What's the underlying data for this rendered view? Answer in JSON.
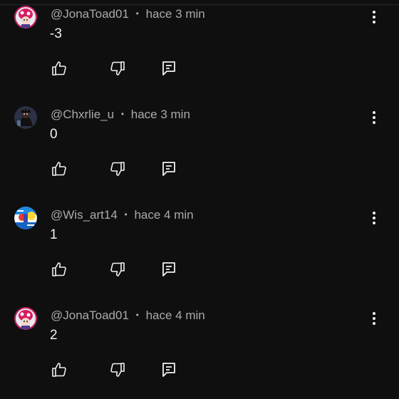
{
  "comments": [
    {
      "author": "@JonaToad01",
      "separator": "•",
      "time": "hace 3 min",
      "text": "-3",
      "avatar": "toad-avatar",
      "accent": "#c2185b"
    },
    {
      "author": "@Chxrlie_u",
      "separator": "•",
      "time": "hace 3 min",
      "text": "0",
      "avatar": "dark-character-avatar",
      "accent": "#3b4a6b"
    },
    {
      "author": "@Wis_art14",
      "separator": "•",
      "time": "hace 4 min",
      "text": "1",
      "avatar": "colorful-art-avatar",
      "accent": "#1e88e5"
    },
    {
      "author": "@JonaToad01",
      "separator": "•",
      "time": "hace 4 min",
      "text": "2",
      "avatar": "toad-avatar",
      "accent": "#c2185b"
    }
  ],
  "icons": {
    "like": "thumb-up-icon",
    "dislike": "thumb-down-icon",
    "reply": "reply-comment-icon",
    "menu": "more-vertical-icon"
  },
  "colors": {
    "background": "#0f0f0f",
    "text_primary": "#f1f1f1",
    "text_secondary": "#aaaaaa"
  }
}
